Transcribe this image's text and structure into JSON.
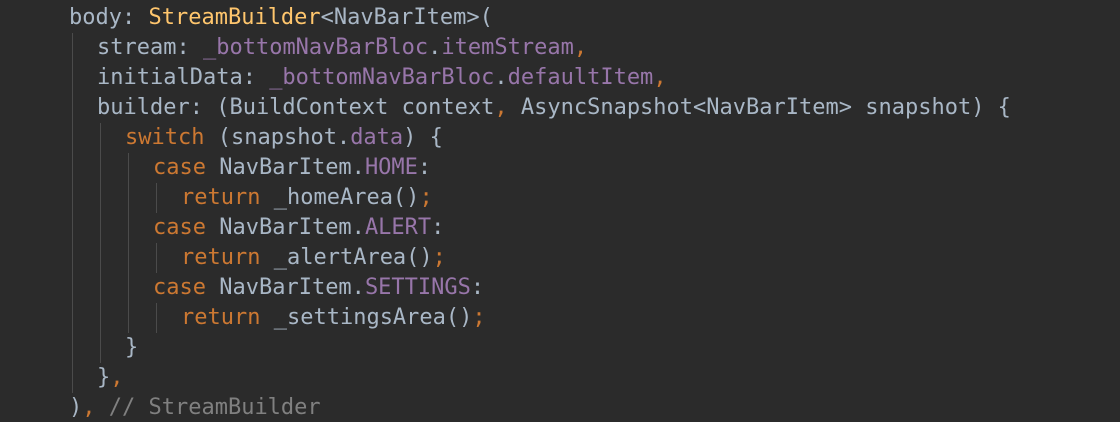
{
  "editor": {
    "lines": [
      {
        "indent": 2,
        "tokens": [
          {
            "t": "body: ",
            "k": "plain"
          },
          {
            "t": "StreamBuilder",
            "k": "class"
          },
          {
            "t": "<NavBarItem>(",
            "k": "plain"
          }
        ]
      },
      {
        "indent": 3,
        "tokens": [
          {
            "t": "stream: ",
            "k": "plain"
          },
          {
            "t": "_bottomNavBarBloc",
            "k": "field"
          },
          {
            "t": ".",
            "k": "plain"
          },
          {
            "t": "itemStream",
            "k": "field"
          },
          {
            "t": ",",
            "k": "punct"
          }
        ]
      },
      {
        "indent": 3,
        "tokens": [
          {
            "t": "initialData: ",
            "k": "plain"
          },
          {
            "t": "_bottomNavBarBloc",
            "k": "field"
          },
          {
            "t": ".",
            "k": "plain"
          },
          {
            "t": "defaultItem",
            "k": "field"
          },
          {
            "t": ",",
            "k": "punct"
          }
        ]
      },
      {
        "indent": 3,
        "tokens": [
          {
            "t": "builder: (BuildContext context",
            "k": "plain"
          },
          {
            "t": ",",
            "k": "punct"
          },
          {
            "t": " AsyncSnapshot<NavBarItem> snapshot) {",
            "k": "plain"
          }
        ]
      },
      {
        "indent": 4,
        "tokens": [
          {
            "t": "switch",
            "k": "kw"
          },
          {
            "t": " (snapshot.",
            "k": "plain"
          },
          {
            "t": "data",
            "k": "field"
          },
          {
            "t": ") {",
            "k": "plain"
          }
        ]
      },
      {
        "indent": 5,
        "tokens": [
          {
            "t": "case",
            "k": "kw"
          },
          {
            "t": " NavBarItem.",
            "k": "plain"
          },
          {
            "t": "HOME",
            "k": "field"
          },
          {
            "t": ":",
            "k": "plain"
          }
        ]
      },
      {
        "indent": 6,
        "tokens": [
          {
            "t": "return",
            "k": "kw"
          },
          {
            "t": " _homeArea()",
            "k": "plain"
          },
          {
            "t": ";",
            "k": "punct"
          }
        ]
      },
      {
        "indent": 5,
        "tokens": [
          {
            "t": "case",
            "k": "kw"
          },
          {
            "t": " NavBarItem.",
            "k": "plain"
          },
          {
            "t": "ALERT",
            "k": "field"
          },
          {
            "t": ":",
            "k": "plain"
          }
        ]
      },
      {
        "indent": 6,
        "tokens": [
          {
            "t": "return",
            "k": "kw"
          },
          {
            "t": " _alertArea()",
            "k": "plain"
          },
          {
            "t": ";",
            "k": "punct"
          }
        ]
      },
      {
        "indent": 5,
        "tokens": [
          {
            "t": "case",
            "k": "kw"
          },
          {
            "t": " NavBarItem.",
            "k": "plain"
          },
          {
            "t": "SETTINGS",
            "k": "field"
          },
          {
            "t": ":",
            "k": "plain"
          }
        ]
      },
      {
        "indent": 6,
        "tokens": [
          {
            "t": "return",
            "k": "kw"
          },
          {
            "t": " _settingsArea()",
            "k": "plain"
          },
          {
            "t": ";",
            "k": "punct"
          }
        ]
      },
      {
        "indent": 4,
        "tokens": [
          {
            "t": "}",
            "k": "plain"
          }
        ]
      },
      {
        "indent": 3,
        "tokens": [
          {
            "t": "}",
            "k": "plain"
          },
          {
            "t": ",",
            "k": "punct"
          }
        ]
      },
      {
        "indent": 2,
        "tokens": [
          {
            "t": ")",
            "k": "plain"
          },
          {
            "t": ",",
            "k": "punct"
          },
          {
            "t": " // StreamBuilder",
            "k": "comment"
          }
        ]
      }
    ],
    "colors": {
      "background": "#2b2b2b",
      "plain": "#a9b7c6",
      "class": "#ffc66d",
      "field": "#9876aa",
      "keyword": "#cc7832",
      "comment": "#808080",
      "indent_guide": "#4b4b4b"
    }
  }
}
